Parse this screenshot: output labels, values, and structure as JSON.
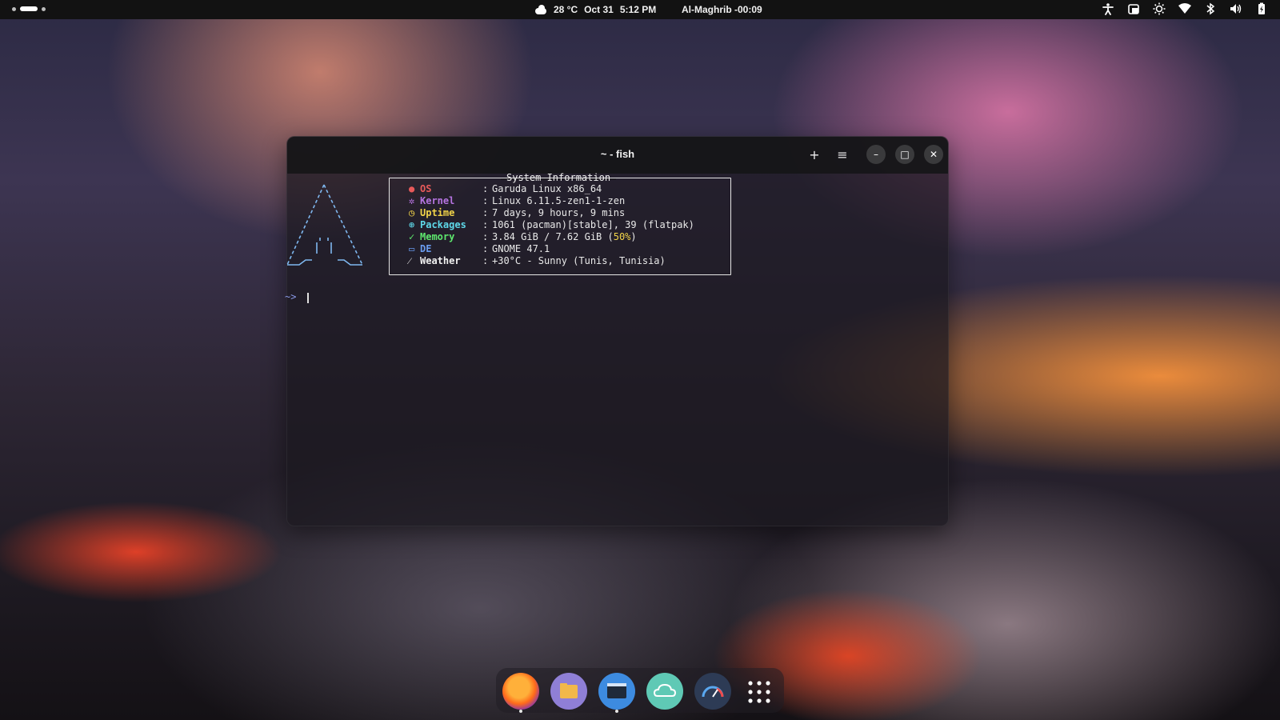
{
  "topbar": {
    "weather_temp": "28 °C",
    "date": "Oct 31",
    "time": "5:12 PM",
    "prayer": "Al-Maghrib -00:09",
    "tray_icons": [
      "accessibility-icon",
      "screenshot-icon",
      "brightness-icon",
      "wifi-icon",
      "bluetooth-icon",
      "volume-icon",
      "battery-icon"
    ]
  },
  "terminal": {
    "title": "~ - fish",
    "new_tab_glyph": "+",
    "menu_glyph": "≡",
    "minimize_glyph": "–",
    "maximize_glyph": "□",
    "close_glyph": "✕",
    "logo_lines": [
      " /\\",
      "/  \\",
      "/    \\",
      "/  ,,  \\",
      "/ |  |  \\",
      "/_-''    ''-_\\"
    ],
    "box_title": "System Information",
    "info": [
      {
        "icon": "●",
        "key": "OS",
        "value": "Garuda Linux x86_64",
        "color": "#e85a5a"
      },
      {
        "icon": "✲",
        "key": "Kernel",
        "value": "Linux 6.11.5-zen1-1-zen",
        "color": "#b574e0"
      },
      {
        "icon": "◷",
        "key": "Uptime",
        "value": "7 days, 9 hours, 9 mins",
        "color": "#f2d449"
      },
      {
        "icon": "⊛",
        "key": "Packages",
        "value": "1061 (pacman)[stable], 39 (flatpak)",
        "color": "#5ed8e8"
      },
      {
        "icon": "✓",
        "key": "Memory",
        "value_pre": "3.84 GiB / 7.62 GiB (",
        "value_pct": "50%",
        "value_post": ")",
        "color": "#5ee86e"
      },
      {
        "icon": "▭",
        "key": "DE",
        "value": "GNOME 47.1",
        "color": "#6a9cf0"
      },
      {
        "icon": "⁄",
        "key": "Weather",
        "value": "+30°C - Sunny (Tunis, Tunisia)",
        "color": "#f0f0f0"
      }
    ],
    "prompt": "~>"
  },
  "dock": {
    "apps": [
      "Firefox",
      "Files",
      "Terminal",
      "Weather",
      "System Monitor",
      "Show Apps"
    ]
  }
}
